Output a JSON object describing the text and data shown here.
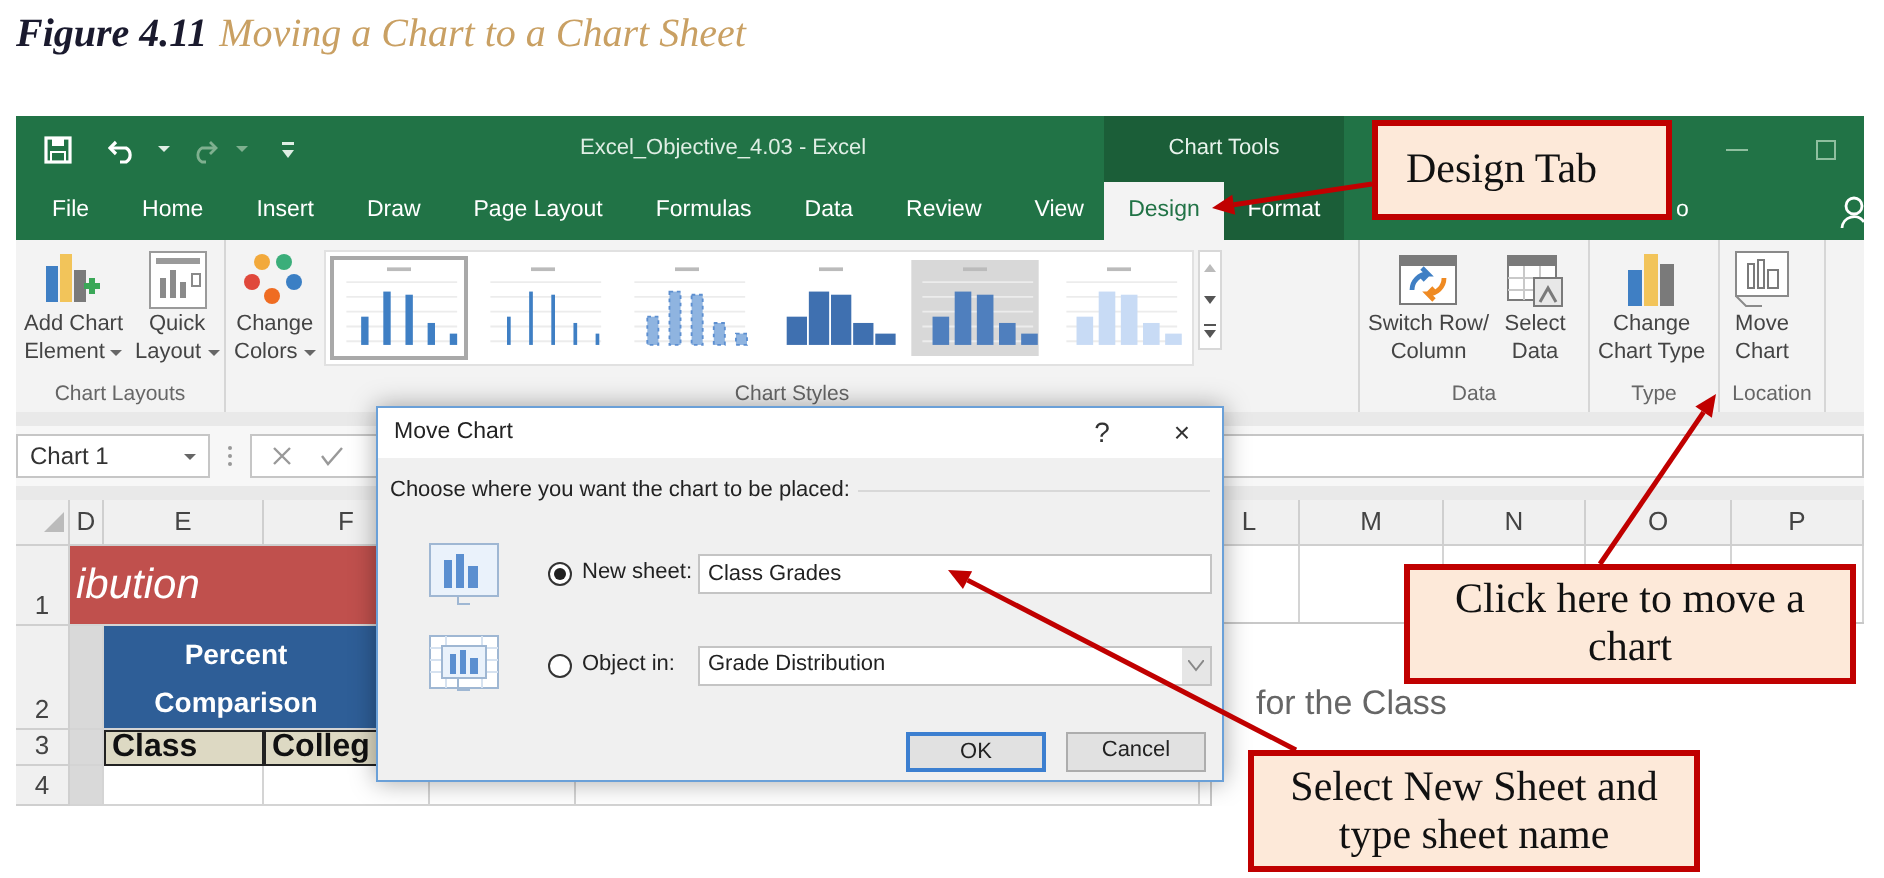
{
  "caption": {
    "label": "Figure 4.11",
    "title": "Moving a Chart to a Chart Sheet"
  },
  "window": {
    "title": "Excel_Objective_4.03 - Excel",
    "context_group": "Chart Tools"
  },
  "tabs": [
    {
      "label": "File",
      "selected": false,
      "contextual": false
    },
    {
      "label": "Home",
      "selected": false,
      "contextual": false
    },
    {
      "label": "Insert",
      "selected": false,
      "contextual": false
    },
    {
      "label": "Draw",
      "selected": false,
      "contextual": false
    },
    {
      "label": "Page Layout",
      "selected": false,
      "contextual": false
    },
    {
      "label": "Formulas",
      "selected": false,
      "contextual": false
    },
    {
      "label": "Data",
      "selected": false,
      "contextual": false
    },
    {
      "label": "Review",
      "selected": false,
      "contextual": false
    },
    {
      "label": "View",
      "selected": false,
      "contextual": false
    },
    {
      "label": "Design",
      "selected": true,
      "contextual": true
    },
    {
      "label": "Format",
      "selected": false,
      "contextual": true
    }
  ],
  "tell_me": "o",
  "ribbon": {
    "groups": [
      {
        "label": "Chart Layouts",
        "buttons": [
          {
            "lines": [
              "Add Chart",
              "Element"
            ],
            "dropdown": true
          },
          {
            "lines": [
              "Quick",
              "Layout"
            ],
            "dropdown": true
          }
        ]
      },
      {
        "label": "Chart Styles",
        "buttons": [
          {
            "lines": [
              "Change",
              "Colors"
            ],
            "dropdown": true
          }
        ],
        "styles": [
          {
            "kind": "thin",
            "selected": true
          },
          {
            "kind": "needle",
            "selected": false
          },
          {
            "kind": "striped",
            "selected": false
          },
          {
            "kind": "solid",
            "selected": false
          },
          {
            "kind": "shaded",
            "selected": false
          },
          {
            "kind": "pale",
            "selected": false
          }
        ]
      },
      {
        "label": "Data",
        "buttons": [
          {
            "lines": [
              "Switch Row/",
              "Column"
            ],
            "dropdown": false
          },
          {
            "lines": [
              "Select",
              "Data"
            ],
            "dropdown": false
          }
        ]
      },
      {
        "label": "Type",
        "buttons": [
          {
            "lines": [
              "Change",
              "Chart Type"
            ],
            "dropdown": false
          }
        ]
      },
      {
        "label": "Location",
        "buttons": [
          {
            "lines": [
              "Move",
              "Chart"
            ],
            "dropdown": false
          }
        ]
      }
    ]
  },
  "name_box": "Chart 1",
  "sheet": {
    "columns": [
      "D",
      "E",
      "F",
      "",
      "",
      "L",
      "M",
      "N",
      "O",
      "P"
    ],
    "rows": [
      {
        "number": "1",
        "title": "ibution"
      },
      {
        "number": "2",
        "header": "Percent Comparison"
      },
      {
        "number": "3",
        "cells": [
          "Class",
          "Colleg"
        ]
      },
      {
        "number": "4"
      }
    ],
    "chart_title": "for the Class"
  },
  "dialog": {
    "title": "Move Chart",
    "help": "?",
    "close": "×",
    "prompt": "Choose where you want the chart to be placed:",
    "options": [
      {
        "label": "New sheet:",
        "selected": true,
        "kind": "text",
        "value": "Class Grades"
      },
      {
        "label": "Object in:",
        "selected": false,
        "kind": "dropdown",
        "value": "Grade Distribution"
      }
    ],
    "buttons": [
      {
        "label": "OK",
        "default": true
      },
      {
        "label": "Cancel",
        "default": false
      }
    ]
  },
  "callouts": [
    {
      "text": "Design Tab"
    },
    {
      "text": "Click here to move a chart"
    },
    {
      "text": "Select New Sheet and type sheet name"
    }
  ]
}
